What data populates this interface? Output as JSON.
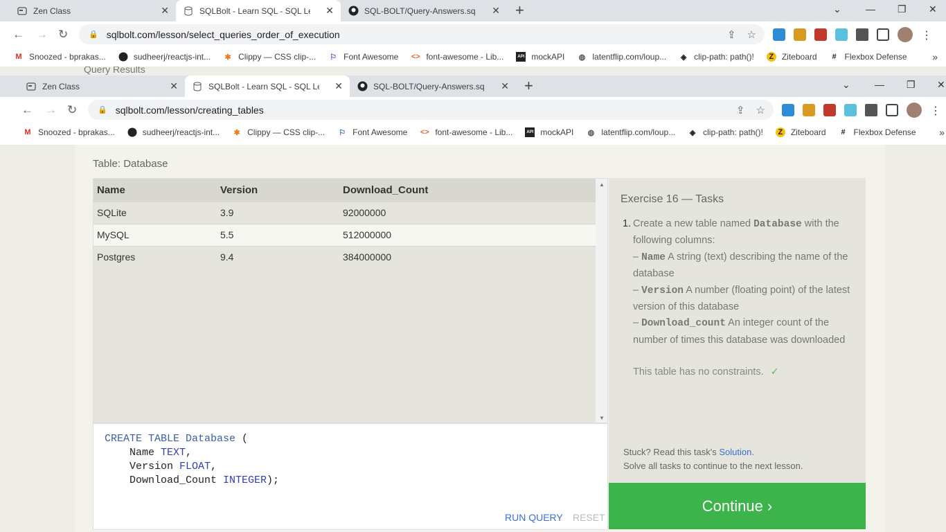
{
  "back_window": {
    "tabs": [
      {
        "label": "Zen Class",
        "icon": "zen-class-icon"
      },
      {
        "label": "SQLBolt - Learn SQL - SQL Lesso",
        "icon": "database-icon"
      },
      {
        "label": "SQL-BOLT/Query-Answers.sql at",
        "icon": "github-icon"
      }
    ],
    "url": "sqlbolt.com/lesson/select_queries_order_of_execution",
    "peek_text": "Query Results"
  },
  "front_window": {
    "tabs": [
      {
        "label": "Zen Class",
        "icon": "zen-class-icon"
      },
      {
        "label": "SQLBolt - Learn SQL - SQL Lesso",
        "icon": "database-icon"
      },
      {
        "label": "SQL-BOLT/Query-Answers.sql at",
        "icon": "github-icon"
      }
    ],
    "url": "sqlbolt.com/lesson/creating_tables"
  },
  "bookmarks": [
    {
      "label": "Snoozed - bprakas...",
      "icon": "gmail-icon"
    },
    {
      "label": "sudheerj/reactjs-int...",
      "icon": "github-icon"
    },
    {
      "label": "Clippy — CSS clip-...",
      "icon": "clippy-icon"
    },
    {
      "label": "Font Awesome",
      "icon": "flag-icon"
    },
    {
      "label": "font-awesome - Lib...",
      "icon": "code-icon"
    },
    {
      "label": "mockAPI",
      "icon": "mockapi-icon"
    },
    {
      "label": "latentflip.com/loup...",
      "icon": "globe-icon"
    },
    {
      "label": "clip-path: path()!",
      "icon": "clip-path-icon"
    },
    {
      "label": "Ziteboard",
      "icon": "ziteboard-icon"
    },
    {
      "label": "Flexbox Defense",
      "icon": "hash-icon"
    }
  ],
  "bookmarks_more": "»",
  "lesson": {
    "table_caption": "Table: Database",
    "columns": [
      "Name",
      "Version",
      "Download_Count"
    ],
    "rows": [
      [
        "SQLite",
        "3.9",
        "92000000"
      ],
      [
        "MySQL",
        "5.5",
        "512000000"
      ],
      [
        "Postgres",
        "9.4",
        "384000000"
      ]
    ],
    "editor": {
      "line1_kw": "CREATE TABLE Database",
      "line1_rest": " (",
      "line2_name": "    Name ",
      "line2_type": "TEXT",
      "line2_end": ",",
      "line3_name": "    Version ",
      "line3_type": "FLOAT",
      "line3_end": ",",
      "line4_name": "    Download_Count ",
      "line4_type": "INTEGER",
      "line4_end": ");",
      "run_label": "RUN QUERY",
      "reset_label": "RESET"
    },
    "exercise": {
      "title": "Exercise 16 — Tasks",
      "number": "1.",
      "intro_a": "Create a new table named ",
      "intro_code": "Database",
      "intro_b": " with the following columns:",
      "col1_code": "Name",
      "col1_desc": " A string (text) describing the name of the database",
      "col2_code": "Version",
      "col2_desc": " A number (floating point) of the latest version of this database",
      "col3_code": "Download_count",
      "col3_desc": " An integer count of the number of times this database was downloaded",
      "dash": "– ",
      "note": "This table has no constraints.",
      "check": "✓",
      "stuck_a": "Stuck? Read this task's ",
      "stuck_link": "Solution",
      "stuck_b": ".",
      "solve_all": "Solve all tasks to continue to the next lesson.",
      "continue_label": "Continue ›"
    }
  },
  "colors": {
    "continue_bg": "#3cb44b",
    "link": "#3a6fd8",
    "sql_keyword": "#3a5fa8"
  }
}
